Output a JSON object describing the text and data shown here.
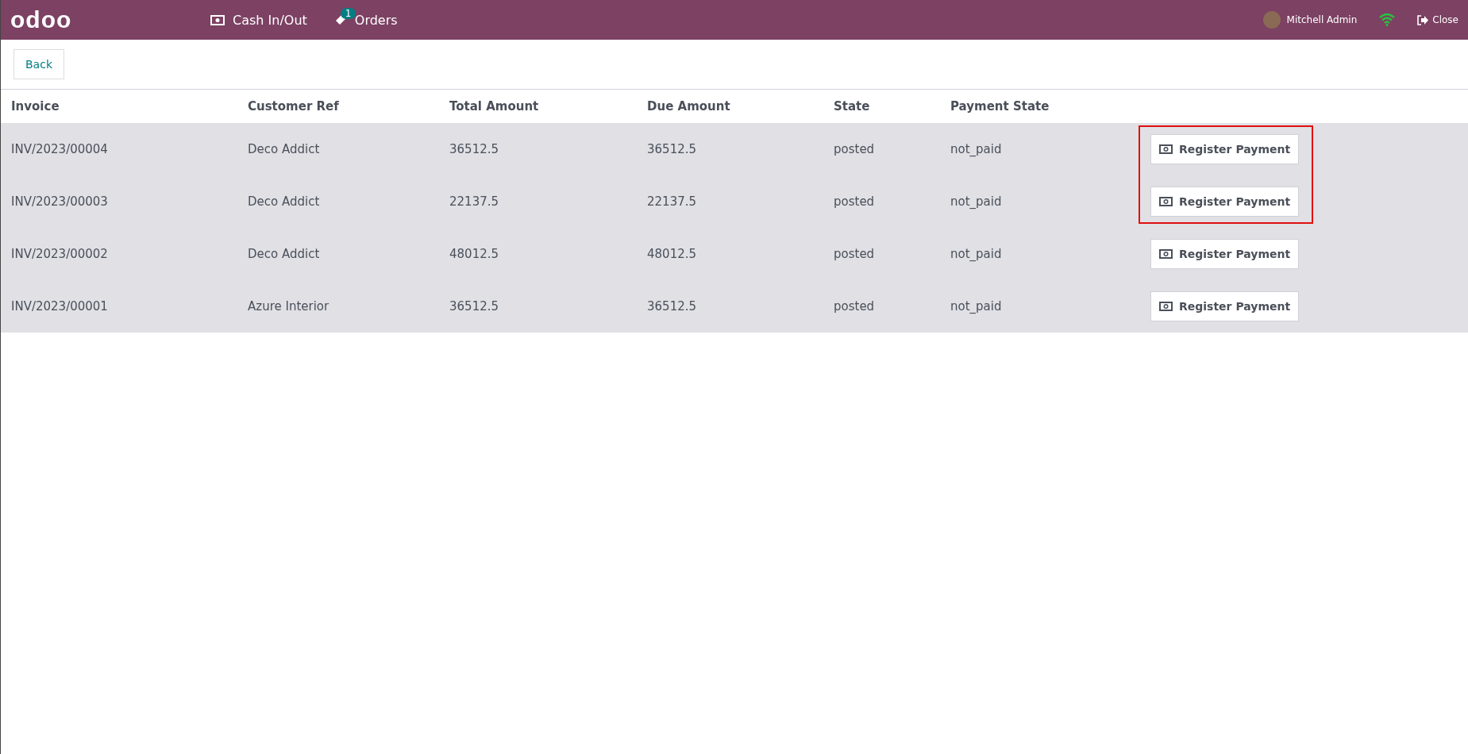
{
  "navbar": {
    "logo": "odoo",
    "items": [
      {
        "kind": "cash",
        "label": "Cash In/Out"
      },
      {
        "kind": "orders",
        "label": "Orders",
        "badge": "1"
      }
    ],
    "user": "Mitchell Admin",
    "close": "Close"
  },
  "back_button": "Back",
  "table": {
    "columns": [
      "Invoice",
      "Customer Ref",
      "Total Amount",
      "Due Amount",
      "State",
      "Payment State"
    ],
    "rows": [
      {
        "cells": [
          "INV/2023/00004",
          "Deco Addict",
          "36512.5",
          "36512.5",
          "posted",
          "not_paid"
        ],
        "action": "Register Payment",
        "highlighted": true
      },
      {
        "cells": [
          "INV/2023/00003",
          "Deco Addict",
          "22137.5",
          "22137.5",
          "posted",
          "not_paid"
        ],
        "action": "Register Payment",
        "highlighted": true
      },
      {
        "cells": [
          "INV/2023/00002",
          "Deco Addict",
          "48012.5",
          "48012.5",
          "posted",
          "not_paid"
        ],
        "action": "Register Payment",
        "highlighted": false
      },
      {
        "cells": [
          "INV/2023/00001",
          "Azure Interior",
          "36512.5",
          "36512.5",
          "posted",
          "not_paid"
        ],
        "action": "Register Payment",
        "highlighted": false
      }
    ]
  }
}
